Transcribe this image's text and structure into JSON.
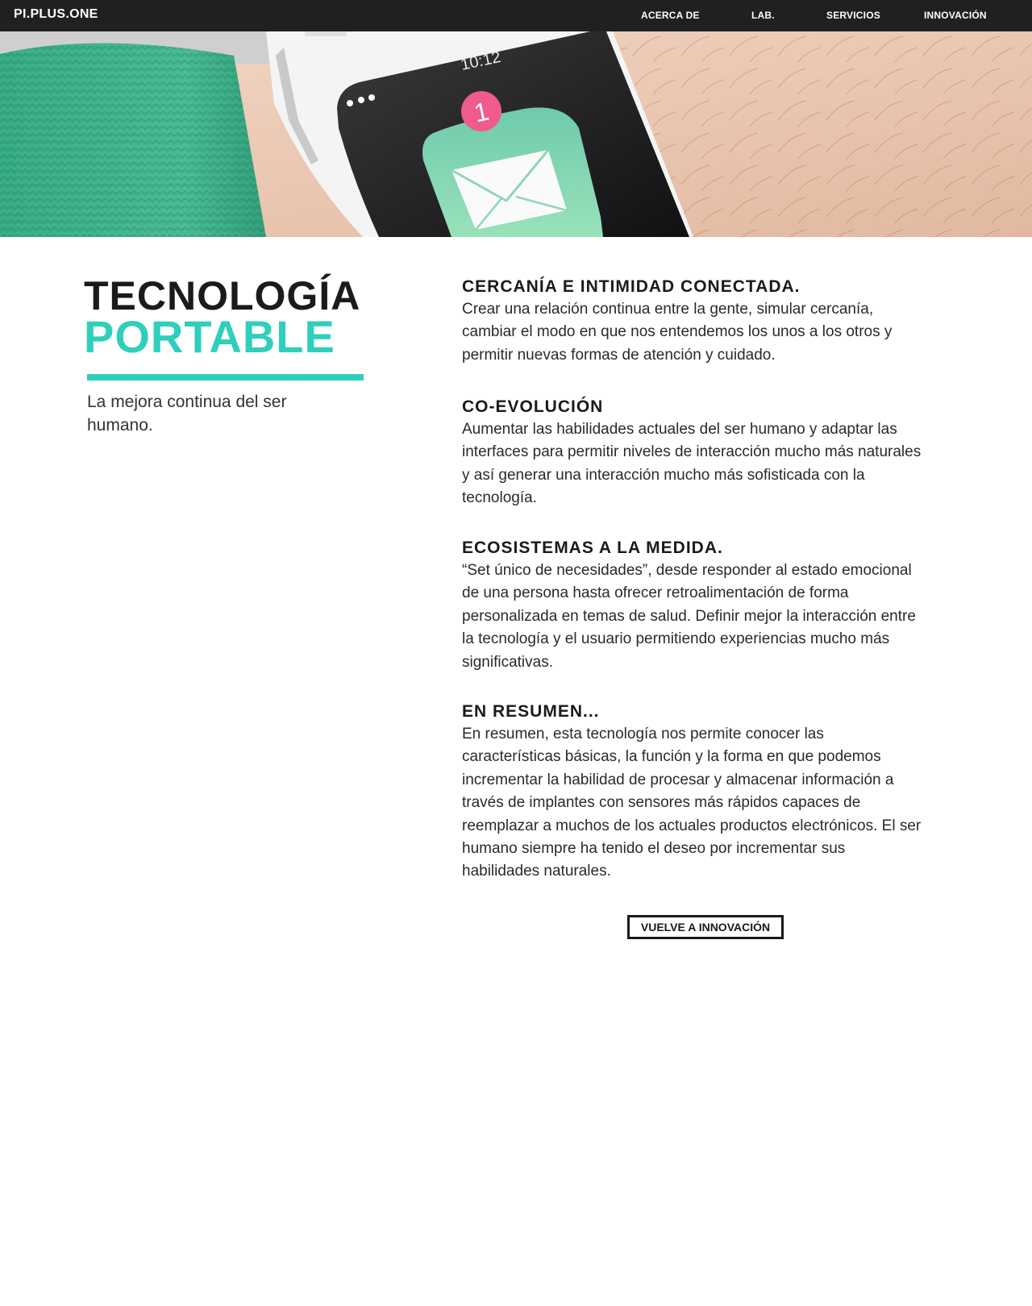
{
  "nav": {
    "brand": "PI.PLUS.ONE",
    "links": [
      {
        "label": "ACERCA DE"
      },
      {
        "label": "LAB."
      },
      {
        "label": "SERVICIOS"
      },
      {
        "label": "INNOVACIÓN"
      }
    ]
  },
  "hero": {
    "watch_time": "10:12",
    "notification_count": "1",
    "icons": [
      "envelope-icon",
      "menu-dots-icon"
    ],
    "colors": {
      "sweater": "#3fb58e",
      "badge": "#ef5b8a",
      "mail_app": "#7fd3b4"
    }
  },
  "intro": {
    "title_line1": "TECNOLOGÍA",
    "title_line2": "PORTABLE",
    "subtitle": "La mejora continua del ser humano.",
    "accent_color": "#2ecfbb"
  },
  "sections": [
    {
      "heading": "CERCANÍA E INTIMIDAD CONECTADA.",
      "body": "Crear una relación continua entre la gente, simular cercanía, cambiar el modo en que nos entendemos los unos a los otros y permitir nuevas formas de atención y cuidado."
    },
    {
      "heading": "CO-EVOLUCIÓN",
      "body": "Aumentar las habilidades actuales del ser humano y adaptar las interfaces para permitir niveles de interacción mucho más naturales y así generar una interacción mucho más sofisticada con la tecnología."
    },
    {
      "heading": "ECOSISTEMAS A LA MEDIDA.",
      "body": "“Set único de necesidades”, desde responder al estado emocional de una persona hasta ofrecer retroalimentación de forma personalizada en temas de salud. Definir mejor la interacción entre la tecnología y el usuario permitiendo experiencias mucho más significativas."
    },
    {
      "heading": "EN RESUMEN...",
      "body": "En resumen, esta tecnología nos permite conocer las características básicas, la función y la forma en que podemos incrementar la habilidad de procesar y almacenar información a través de implantes con sensores más rápidos capaces de reemplazar a muchos de los actuales productos electrónicos. El ser humano siempre ha tenido el deseo por incrementar sus habilidades naturales."
    }
  ],
  "back_button": {
    "label": "VUELVE A INNOVACIÓN"
  }
}
